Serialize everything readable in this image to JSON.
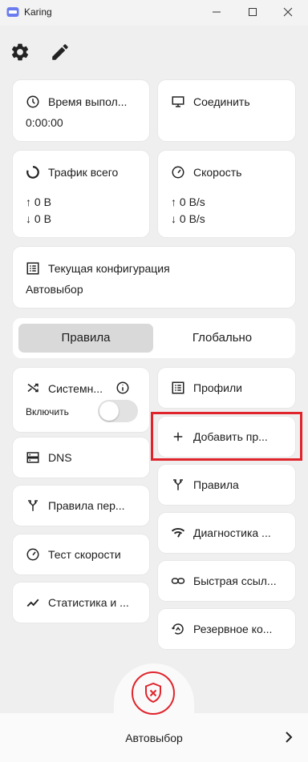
{
  "window": {
    "title": "Karing"
  },
  "cards": {
    "uptime": {
      "title": "Время выпол...",
      "value": "0:00:00"
    },
    "connect": {
      "title": "Соединить"
    },
    "traffic": {
      "title": "Трафик всего",
      "up": "↑ 0 B",
      "down": "↓ 0 B"
    },
    "speed": {
      "title": "Скорость",
      "up": "↑ 0 B/s",
      "down": "↓ 0 B/s"
    },
    "config": {
      "title": "Текущая конфигурация",
      "value": "Автовыбор"
    }
  },
  "mode": {
    "options": [
      "Правила",
      "Глобально"
    ],
    "selected": "Правила"
  },
  "system_proxy": {
    "title": "Системн...",
    "toggle_label": "Включить",
    "enabled": false
  },
  "left_items": [
    "DNS",
    "Правила пер...",
    "Тест скорости",
    "Статистика и ..."
  ],
  "right_items": [
    "Профили",
    "Добавить пр...",
    "Правила",
    "Диагностика ...",
    "Быстрая ссыл...",
    "Резервное ко..."
  ],
  "bottom": {
    "label": "Автовыбор"
  },
  "colors": {
    "accent": "#e0242b",
    "card": "#ffffff",
    "background": "#efefef"
  }
}
